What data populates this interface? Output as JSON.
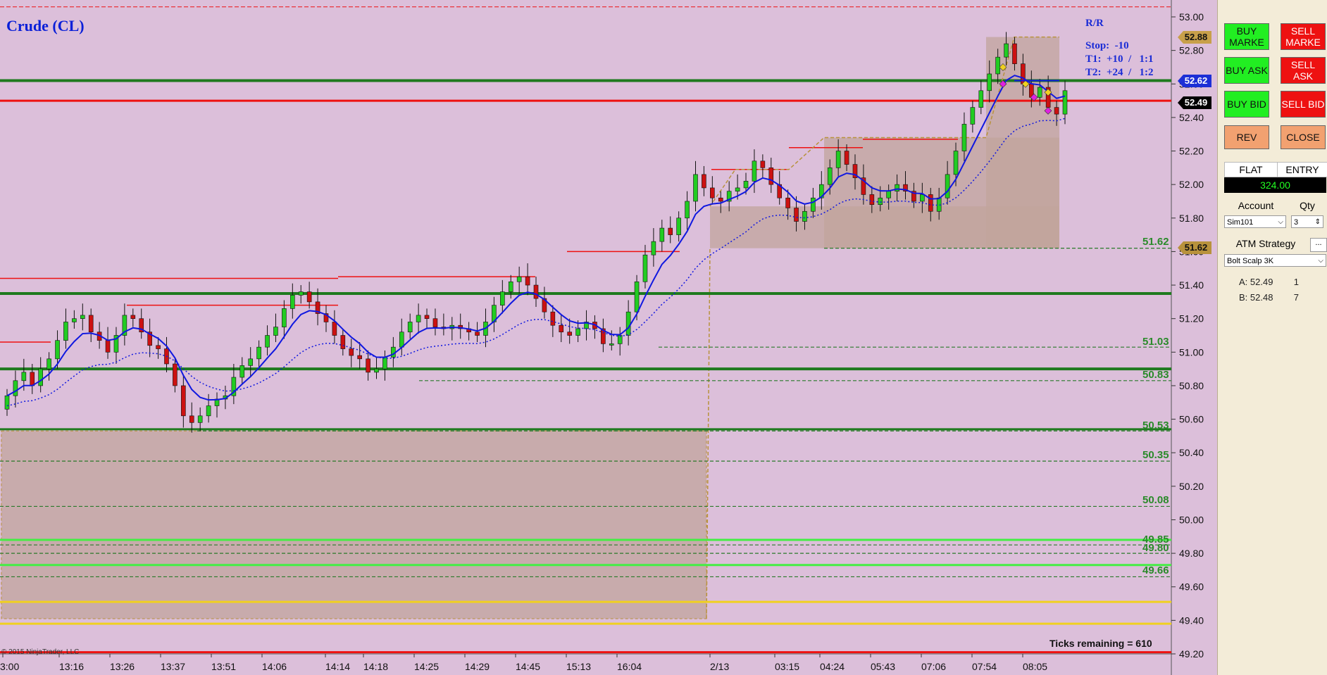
{
  "chart": {
    "title": "Crude (CL)",
    "copyright": "© 2015 NinjaTrader, LLC",
    "ticks_remaining": "Ticks remaining = 610",
    "rr": {
      "heading": "R/R",
      "stop": "Stop:  -10",
      "t1": "T1:  +10  /   1:1",
      "t2": "T2:  +24  /   1:2"
    },
    "level_labels": [
      "51.62",
      "51.03",
      "50.83",
      "50.53",
      "50.35",
      "50.08",
      "49.85",
      "49.80",
      "49.66"
    ],
    "price_tags": {
      "target": "52.88",
      "entry_line": "52.62",
      "last": "52.49",
      "stop_level": "51.62"
    },
    "colors": {
      "background": "#dcbfda",
      "up_candle": "#22cc22",
      "down_candle": "#cc1111",
      "ema": "#1018e0",
      "support": "#1e7a1e",
      "resistance": "#ee1111"
    }
  },
  "chart_data": {
    "type": "candlestick",
    "title": "Crude (CL)",
    "y_axis": {
      "min": 49.2,
      "max": 53.0,
      "ticks": [
        "53.00",
        "52.80",
        "52.60",
        "52.40",
        "52.20",
        "52.00",
        "51.80",
        "51.60",
        "51.40",
        "51.20",
        "51.00",
        "50.80",
        "50.60",
        "50.40",
        "50.20",
        "50.00",
        "49.80",
        "49.60",
        "49.40",
        "49.20"
      ]
    },
    "x_ticks": [
      "3:00",
      "13:16",
      "13:26",
      "13:37",
      "13:51",
      "14:06",
      "14:14",
      "14:18",
      "14:25",
      "14:29",
      "14:45",
      "15:13",
      "16:04",
      "2/13",
      "03:15",
      "04:24",
      "05:43",
      "07:06",
      "07:54",
      "08:05"
    ],
    "horizontal_levels": [
      51.62,
      51.03,
      50.83,
      50.53,
      50.35,
      50.08,
      49.85,
      49.8,
      49.66
    ],
    "closes": [
      50.74,
      50.83,
      50.88,
      50.8,
      50.9,
      50.96,
      51.07,
      51.18,
      51.2,
      51.22,
      51.12,
      51.07,
      51.0,
      51.1,
      51.22,
      51.2,
      51.12,
      51.04,
      51.02,
      50.93,
      50.8,
      50.62,
      50.58,
      50.62,
      50.68,
      50.72,
      50.74,
      50.85,
      50.92,
      50.96,
      51.03,
      51.1,
      51.15,
      51.26,
      51.34,
      51.36,
      51.3,
      51.23,
      51.18,
      51.1,
      51.02,
      50.98,
      50.96,
      50.88,
      50.9,
      50.97,
      51.03,
      51.12,
      51.18,
      51.22,
      51.2,
      51.15,
      51.14,
      51.16,
      51.14,
      51.12,
      51.1,
      51.18,
      51.28,
      51.36,
      51.42,
      51.45,
      51.4,
      51.32,
      51.24,
      51.16,
      51.12,
      51.1,
      51.14,
      51.18,
      51.14,
      51.05,
      51.05,
      51.1,
      51.24,
      51.42,
      51.58,
      51.66,
      51.74,
      51.7,
      51.8,
      51.9,
      52.06,
      51.98,
      51.92,
      51.9,
      51.96,
      51.98,
      52.02,
      52.14,
      52.1,
      52.0,
      51.92,
      51.86,
      51.78,
      51.84,
      51.92,
      52.0,
      52.1,
      52.2,
      52.12,
      52.04,
      51.94,
      51.88,
      51.92,
      51.96,
      52.0,
      51.96,
      51.9,
      51.94,
      51.84,
      51.92,
      52.06,
      52.2,
      52.36,
      52.46,
      52.56,
      52.66,
      52.76,
      52.84,
      52.72,
      52.6,
      52.52,
      52.58,
      52.46,
      52.42,
      52.56
    ]
  },
  "panel": {
    "buttons": {
      "buy_market": "BUY MARKE",
      "sell_market": "SELL MARKE",
      "buy_ask": "BUY ASK",
      "sell_ask": "SELL ASK",
      "buy_bid": "BUY BID",
      "sell_bid": "SELL BID",
      "rev": "REV",
      "close": "CLOSE"
    },
    "position": "FLAT",
    "entry_label": "ENTRY",
    "pnl": "324.00",
    "account_label": "Account",
    "qty_label": "Qty",
    "account_value": "Sim101",
    "qty_value": "3",
    "atm_label": "ATM Strategy",
    "atm_more": "...",
    "atm_value": "Bolt Scalp 3K",
    "ask_label": "A:",
    "ask_price": "52.49",
    "ask_size": "1",
    "bid_label": "B:",
    "bid_price": "52.48",
    "bid_size": "7"
  }
}
